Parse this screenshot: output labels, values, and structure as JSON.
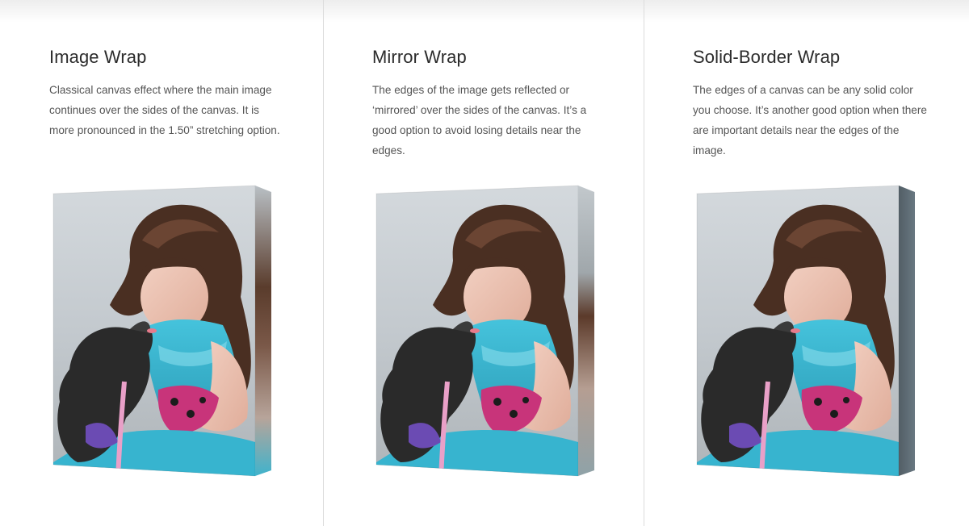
{
  "options": [
    {
      "title": "Image Wrap",
      "description": "Classical canvas effect where the main image continues over the sides of the canvas. It is more pronounced in the 1.50” stretching option.",
      "edge": "image"
    },
    {
      "title": "Mirror Wrap",
      "description": "The edges of the image gets reflected or ‘mirrored’ over the sides of the canvas. It’s a good option to avoid losing details near the edges.",
      "edge": "mirror"
    },
    {
      "title": "Solid-Border Wrap",
      "description": "The edges of a canvas can be any solid color you choose. It’s another good option when there are important details near the edges of the image.",
      "edge": "solid"
    }
  ],
  "colors": {
    "dress": "#3ab5cf",
    "hair": "#4a2f22",
    "dog": "#2a2a2a",
    "background": "#c9cfd4",
    "solid_edge": "#6e7e88"
  }
}
